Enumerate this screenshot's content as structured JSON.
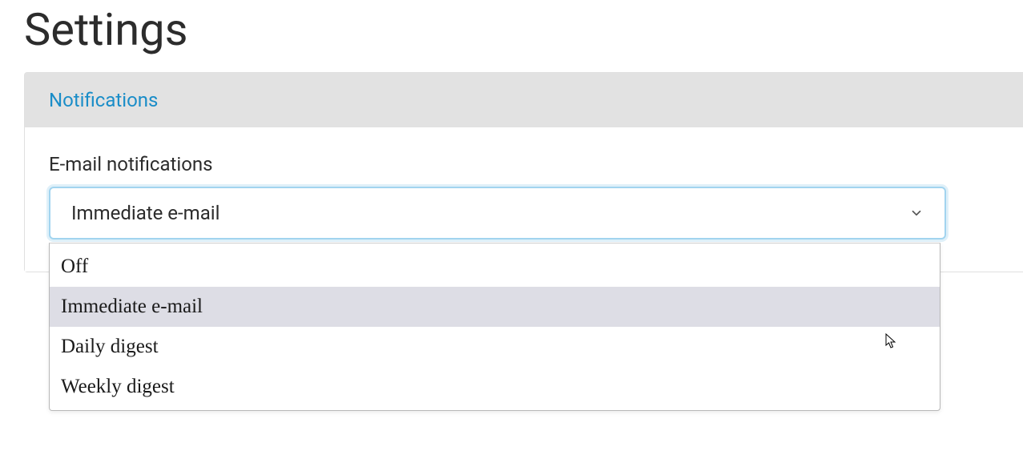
{
  "page": {
    "title": "Settings"
  },
  "tabs": {
    "notifications": "Notifications"
  },
  "form": {
    "emailNotifications": {
      "label": "E-mail notifications",
      "selected": "Immediate e-mail",
      "options": [
        "Off",
        "Immediate e-mail",
        "Daily digest",
        "Weekly digest"
      ],
      "highlightedIndex": 1
    }
  }
}
